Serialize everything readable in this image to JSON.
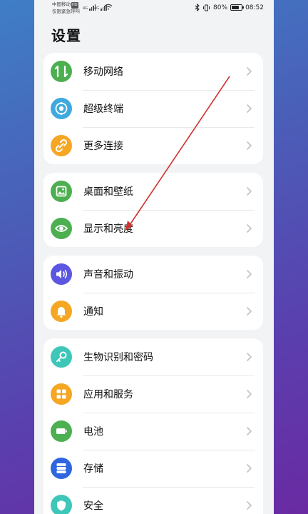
{
  "status_bar": {
    "carrier_line1": "中国移动",
    "carrier_hd": "HD",
    "carrier_line2": "仅限紧急呼叫",
    "signal1_label": "4G",
    "signal2_label": "4G",
    "battery_percent": "80%",
    "battery_level": 0.8,
    "time": "08:52"
  },
  "page": {
    "title": "设置"
  },
  "groups": [
    {
      "items": [
        {
          "label": "移动网络",
          "icon": "mobile-data-icon",
          "color": "#4caf50"
        },
        {
          "label": "超级终端",
          "icon": "super-device-icon",
          "color": "#3fa9e0"
        },
        {
          "label": "更多连接",
          "icon": "link-icon",
          "color": "#f5a623"
        }
      ]
    },
    {
      "items": [
        {
          "label": "桌面和壁纸",
          "icon": "wallpaper-icon",
          "color": "#4caf50"
        },
        {
          "label": "显示和亮度",
          "icon": "eye-icon",
          "color": "#4caf50"
        }
      ]
    },
    {
      "items": [
        {
          "label": "声音和振动",
          "icon": "speaker-icon",
          "color": "#5b57e0"
        },
        {
          "label": "通知",
          "icon": "bell-icon",
          "color": "#f5a623"
        }
      ]
    },
    {
      "items": [
        {
          "label": "生物识别和密码",
          "icon": "key-icon",
          "color": "#3ec6b8"
        },
        {
          "label": "应用和服务",
          "icon": "apps-icon",
          "color": "#f5a623"
        },
        {
          "label": "电池",
          "icon": "battery-icon",
          "color": "#4caf50"
        },
        {
          "label": "存储",
          "icon": "storage-icon",
          "color": "#2f66e0"
        },
        {
          "label": "安全",
          "icon": "shield-icon",
          "color": "#3ec6b8"
        }
      ]
    }
  ]
}
